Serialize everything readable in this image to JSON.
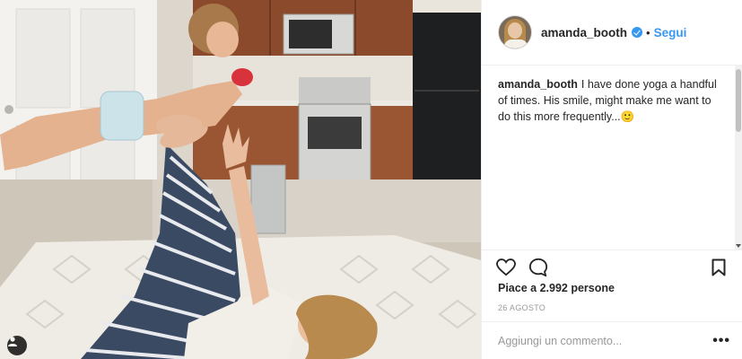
{
  "header": {
    "username": "amanda_booth",
    "separator": "•",
    "follow_label": "Segui"
  },
  "caption": {
    "username": "amanda_booth",
    "text": "I have done yoga a handful of times. His smile, might make me want to do this more frequently...",
    "emoji": "🙂"
  },
  "actions": {
    "like_icon": "heart-icon",
    "comment_icon": "comment-icon",
    "save_icon": "bookmark-icon"
  },
  "likes_text": "Piace a 2.992 persone",
  "date_text": "26 AGOSTO",
  "comment": {
    "placeholder": "Aggiungi un commento...",
    "more_label": "•••"
  },
  "colors": {
    "link_blue": "#3897f0",
    "text": "#262626",
    "muted": "#999999"
  }
}
